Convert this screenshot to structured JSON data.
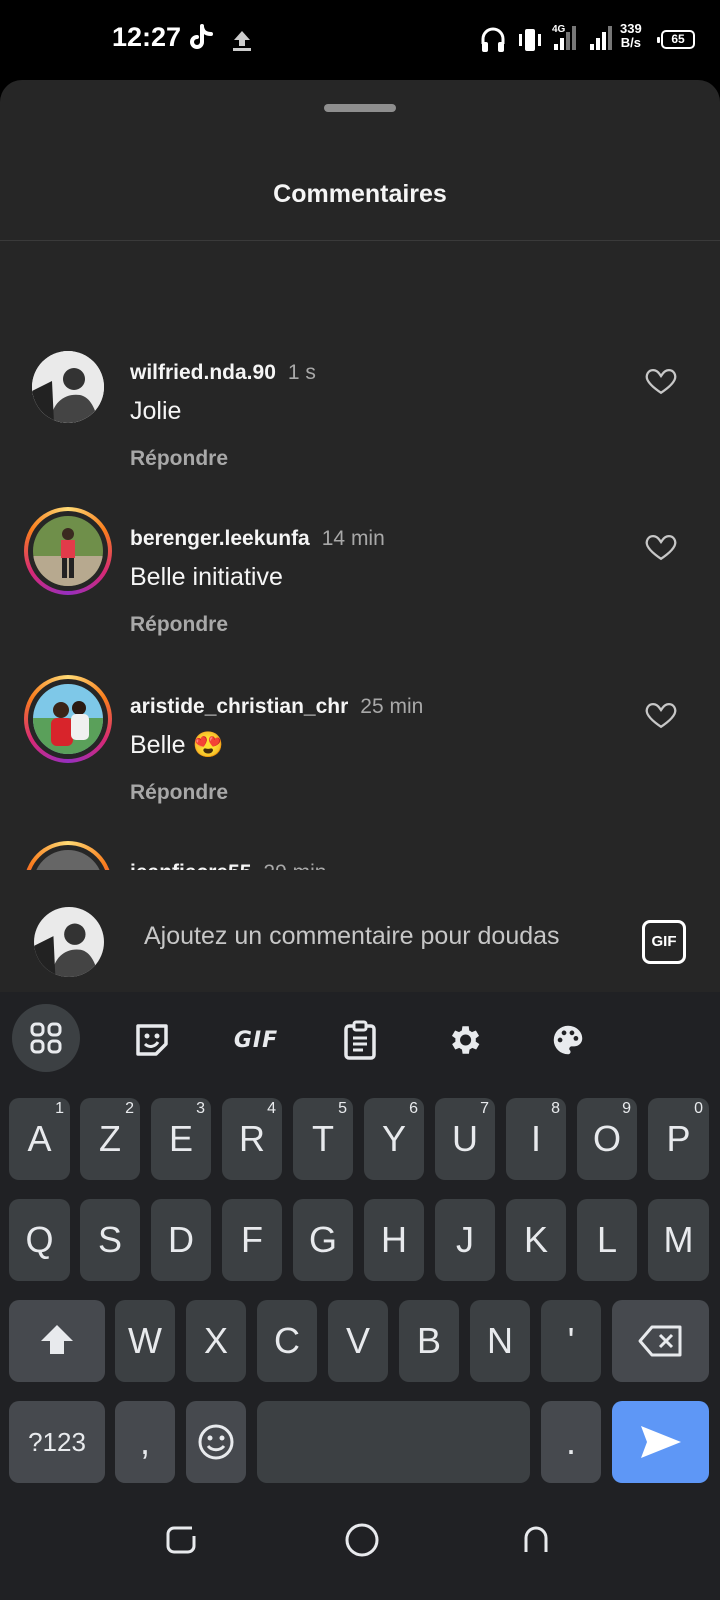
{
  "status_bar": {
    "time": "12:27",
    "net_speed_value": "339",
    "net_speed_unit": "B/s",
    "battery": "65",
    "icons": [
      "tiktok-icon",
      "upload-icon",
      "headphones-icon",
      "vibrate-icon",
      "4g-icon",
      "signal-icon",
      "signal-icon"
    ]
  },
  "sheet": {
    "title": "Commentaires"
  },
  "comments": [
    {
      "username": "wilfried.nda.90",
      "time": "1 s",
      "text": "Jolie",
      "reply": "Répondre",
      "story_ring": false
    },
    {
      "username": "berenger.leekunfa",
      "time": "14 min",
      "text": "Belle initiative",
      "reply": "Répondre",
      "story_ring": true
    },
    {
      "username": "aristide_christian_chr",
      "time": "25 min",
      "text": "Belle 😍",
      "reply": "Répondre",
      "story_ring": true
    },
    {
      "username": "jeanfiacre55",
      "time": "29 min",
      "text": "",
      "reply": "",
      "story_ring": true
    }
  ],
  "emoji_bar": [
    "❤️",
    "🙌",
    "🔥",
    "👏",
    "😢",
    "😍",
    "😮",
    "😂"
  ],
  "comment_input": {
    "placeholder": "Ajoutez un commentaire pour doudas",
    "gif_label": "GIF"
  },
  "keyboard": {
    "toolbar": [
      "apps-grid-icon",
      "sticker-icon",
      "gif",
      "clipboard-icon",
      "settings-gear-icon",
      "palette-icon"
    ],
    "toolbar_gif_label": "GIF",
    "row1": [
      {
        "key": "A",
        "hint": "1"
      },
      {
        "key": "Z",
        "hint": "2"
      },
      {
        "key": "E",
        "hint": "3"
      },
      {
        "key": "R",
        "hint": "4"
      },
      {
        "key": "T",
        "hint": "5"
      },
      {
        "key": "Y",
        "hint": "6"
      },
      {
        "key": "U",
        "hint": "7"
      },
      {
        "key": "I",
        "hint": "8"
      },
      {
        "key": "O",
        "hint": "9"
      },
      {
        "key": "P",
        "hint": "0"
      }
    ],
    "row2": [
      "Q",
      "S",
      "D",
      "F",
      "G",
      "H",
      "J",
      "K",
      "L",
      "M"
    ],
    "row3": [
      "W",
      "X",
      "C",
      "V",
      "B",
      "N",
      "'"
    ],
    "row4": {
      "symbols": "?123",
      "comma": ",",
      "period": "."
    }
  },
  "colors": {
    "sheet_bg": "#262626",
    "keyboard_bg": "#202124",
    "key_bg": "#3c4043",
    "enter_key": "#5e97f6",
    "secondary_text": "#a8a8a8"
  }
}
